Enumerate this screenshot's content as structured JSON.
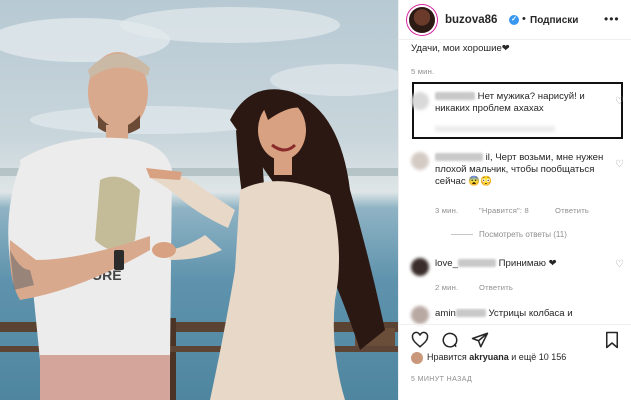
{
  "post": {
    "username": "buzova86",
    "dot": "•",
    "follow_label": "Подписки",
    "more": "•••"
  },
  "caption": {
    "text": "Удачи, мои хорошие❤",
    "time": "5 мин."
  },
  "comments": [
    {
      "text": "Нет мужика? нарисуй! и никаких проблем ахахах",
      "highlighted": true
    },
    {
      "name_visible": "il",
      "text": "Черт возьми, мне нужен плохой мальчик, чтобы пообщаться сейчас 😨😳",
      "time": "3 мин.",
      "likes": "\"Нравится\": 8",
      "reply": "Ответить",
      "view_replies": "Посмотреть ответы (11)"
    },
    {
      "name_visible": "love_",
      "text": "Принимаю ❤",
      "time": "2 мин.",
      "reply": "Ответить"
    },
    {
      "name_visible": "amin",
      "text": "Устрицы колбаса и"
    }
  ],
  "likes_line": {
    "prefix": "Нравится",
    "user": "akryuana",
    "suffix": "и ещё 10 156"
  },
  "timeago": "5 МИНУТ НАЗАД",
  "colors": {
    "verified": "#3897f0",
    "meta": "#8e8e8e",
    "highlight_border": "#111111"
  }
}
